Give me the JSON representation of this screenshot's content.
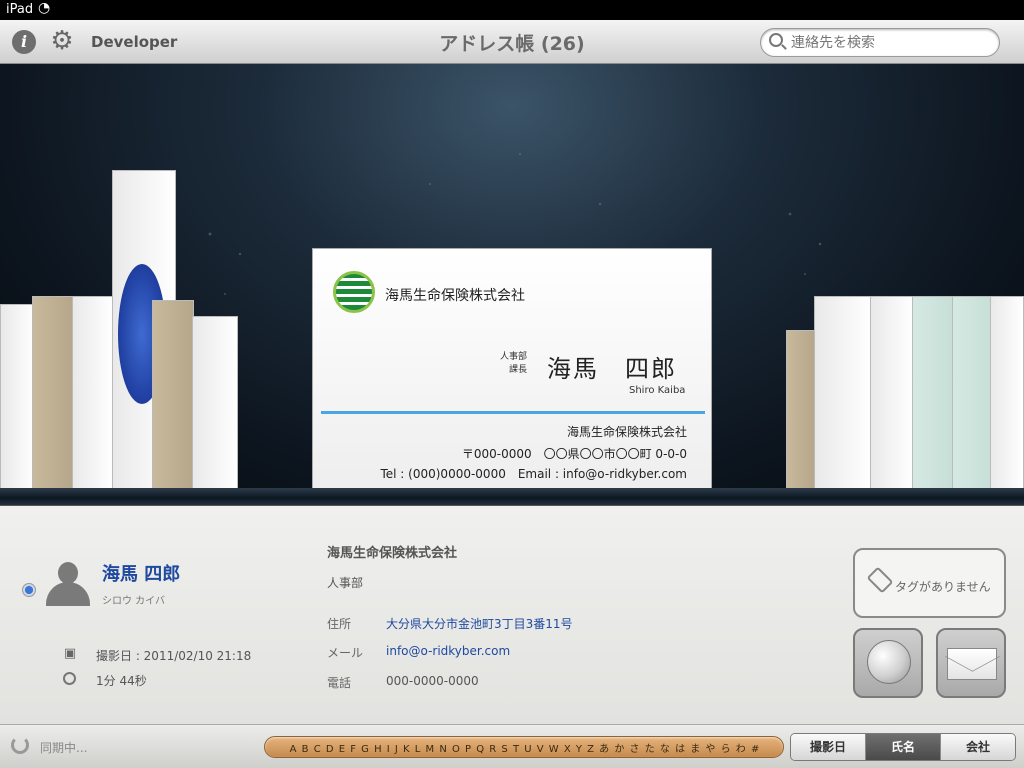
{
  "status": {
    "carrier": "iPad",
    "wifi": "wifi-icon"
  },
  "nav": {
    "info_icon": "i",
    "account": "Developer",
    "title": "アドレス帳 (26)",
    "search_placeholder": "連絡先を検索"
  },
  "card": {
    "company": "海馬生命保険株式会社",
    "dept": "人事部",
    "position": "課長",
    "name": "海馬　四郎",
    "romaji": "Shiro Kaiba",
    "company_bottom": "海馬生命保険株式会社",
    "address": "〒000-0000　〇〇県〇〇市〇〇町 0-0-0",
    "contact": "Tel : (000)0000-0000　Email : info@o-ridkyber.com"
  },
  "detail": {
    "name": "海馬 四郎",
    "kana": "シロウ カイバ",
    "shot_date": "撮影日 : 2011/02/10 21:18",
    "duration": "1分 44秒",
    "company": "海馬生命保険株式会社",
    "dept": "人事部",
    "address_label": "住所",
    "address": "大分県大分市金池町3丁目3番11号",
    "mail_label": "メール",
    "mail": "info@o-ridkyber.com",
    "tel_label": "電話",
    "tel": "000-0000-0000",
    "tag_label": "タグがありません"
  },
  "bottom": {
    "sync": "同期中...",
    "index": "A B C D E F G H I J K L M N O P Q R S T U V W X Y Z あ か さ た な は ま や ら わ #",
    "sort_options": [
      "撮影日",
      "氏名",
      "会社"
    ],
    "active_sort": "氏名"
  },
  "colors": {
    "accent": "#1f4aa0",
    "rule": "#4aa6e0",
    "index": "#d9a06a"
  }
}
